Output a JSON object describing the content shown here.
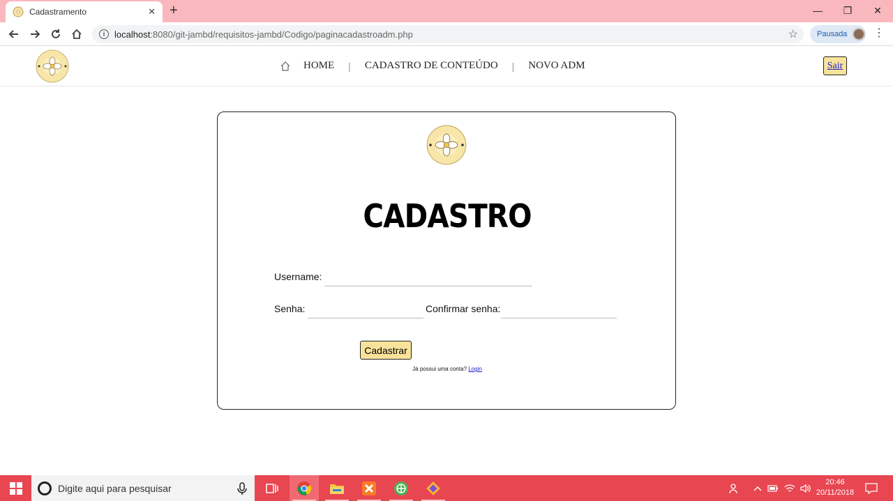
{
  "browser": {
    "tab_title": "Cadastramento",
    "tab_close": "✕",
    "new_tab": "+",
    "url_host": "localhost",
    "url_path": ":8080/git-jambd/requisitos-jambd/Codigo/paginacadastroadm.php",
    "profile_label": "Pausada",
    "window_controls": {
      "minimize": "—",
      "restore": "❐",
      "close": "✕"
    }
  },
  "site": {
    "nav": {
      "items": [
        "HOME",
        "CADASTRO DE CONTEÚDO",
        "NOVO ADM"
      ],
      "separator": "|"
    },
    "logout_label": "Sair"
  },
  "form": {
    "heading": "CADASTRO",
    "username_label": "Username:",
    "senha_label": "Senha:",
    "confirmar_label": "Confirmar senha:",
    "submit_label": "Cadastrar",
    "login_prompt": "Já possui uma conta?",
    "login_link": "Login"
  },
  "taskbar": {
    "search_placeholder": "Digite aqui para pesquisar",
    "time": "20:46",
    "date": "20/11/2018"
  },
  "colors": {
    "tabbar": "#f8b8bd",
    "taskbar": "#e84651",
    "button_fill": "#f9e39a",
    "link": "#1a1acc"
  }
}
